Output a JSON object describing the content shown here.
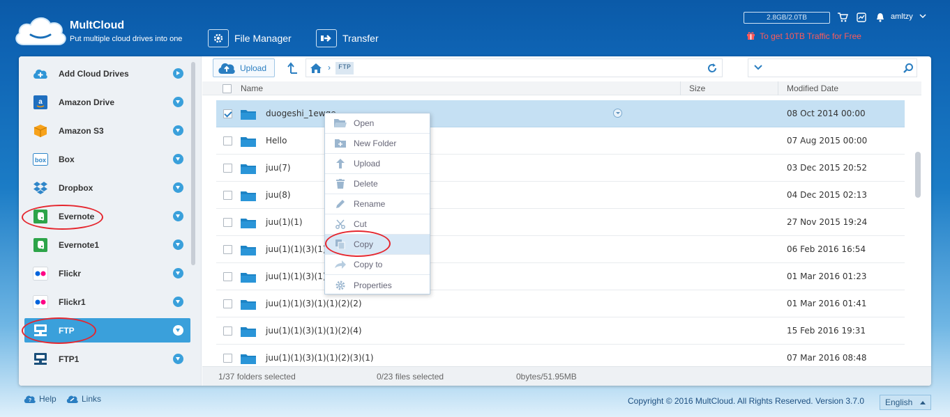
{
  "brand": {
    "name": "MultCloud",
    "tagline": "Put multiple cloud drives into one"
  },
  "topnav": {
    "file_manager": "File Manager",
    "transfer": "Transfer"
  },
  "account": {
    "quota": "2.8GB/2.0TB",
    "username": "amltzy",
    "promo": "To get 10TB Traffic for Free"
  },
  "sidebar": {
    "items": [
      {
        "label": "Add Cloud Drives",
        "icon": "add-cloud-icon"
      },
      {
        "label": "Amazon Drive",
        "icon": "amazon-drive-icon"
      },
      {
        "label": "Amazon S3",
        "icon": "amazon-s3-icon"
      },
      {
        "label": "Box",
        "icon": "box-icon"
      },
      {
        "label": "Dropbox",
        "icon": "dropbox-icon"
      },
      {
        "label": "Evernote",
        "icon": "evernote-icon"
      },
      {
        "label": "Evernote1",
        "icon": "evernote-icon"
      },
      {
        "label": "Flickr",
        "icon": "flickr-icon"
      },
      {
        "label": "Flickr1",
        "icon": "flickr-icon"
      },
      {
        "label": "FTP",
        "icon": "ftp-icon"
      },
      {
        "label": "FTP1",
        "icon": "ftp-icon"
      }
    ]
  },
  "toolbar": {
    "upload_label": "Upload",
    "path_chip": "FTP"
  },
  "table": {
    "headers": {
      "name": "Name",
      "size": "Size",
      "modified": "Modified Date"
    },
    "rows": [
      {
        "name": "duogeshi_1ewqe",
        "date": "08 Oct 2014 00:00",
        "checked": true
      },
      {
        "name": "Hello",
        "date": "07 Aug 2015 00:00",
        "checked": false
      },
      {
        "name": "juu(7)",
        "date": "03 Dec 2015 20:52",
        "checked": false
      },
      {
        "name": "juu(8)",
        "date": "04 Dec 2015 02:13",
        "checked": false
      },
      {
        "name": "juu(1)(1)",
        "date": "27 Nov 2015 19:24",
        "checked": false
      },
      {
        "name": "juu(1)(1)(3)(1)",
        "date": "06 Feb 2016 16:54",
        "checked": false
      },
      {
        "name": "juu(1)(1)(3)(1)",
        "date": "01 Mar 2016 01:23",
        "checked": false
      },
      {
        "name": "juu(1)(1)(3)(1)(1)(2)(2)",
        "date": "01 Mar 2016 01:41",
        "checked": false
      },
      {
        "name": "juu(1)(1)(3)(1)(1)(2)(4)",
        "date": "15 Feb 2016 19:31",
        "checked": false
      },
      {
        "name": "juu(1)(1)(3)(1)(1)(2)(3)(1)",
        "date": "07 Mar 2016 08:48",
        "checked": false
      }
    ]
  },
  "context_menu": {
    "items": [
      {
        "label": "Open",
        "icon": "open-folder-icon"
      },
      {
        "label": "New Folder",
        "icon": "new-folder-icon"
      },
      {
        "label": "Upload",
        "icon": "upload-icon"
      },
      {
        "label": "Delete",
        "icon": "trash-icon"
      },
      {
        "label": "Rename",
        "icon": "pencil-icon"
      },
      {
        "label": "Cut",
        "icon": "scissors-icon"
      },
      {
        "label": "Copy",
        "icon": "copy-icon"
      },
      {
        "label": "Copy to",
        "icon": "copy-to-icon"
      },
      {
        "label": "Properties",
        "icon": "gear-icon"
      }
    ],
    "highlighted": "Copy"
  },
  "status": {
    "folders": "1/37 folders selected",
    "files": "0/23 files selected",
    "size": "0bytes/51.95MB"
  },
  "footer": {
    "help": "Help",
    "links": "Links",
    "copyright": "Copyright © 2016 MultCloud. All Rights Reserved. Version 3.7.0",
    "language": "English"
  },
  "colors": {
    "accent": "#3aa0db",
    "selection": "#c5e0f3",
    "annotation": "#e5262e",
    "promo": "#ff5a5a"
  }
}
